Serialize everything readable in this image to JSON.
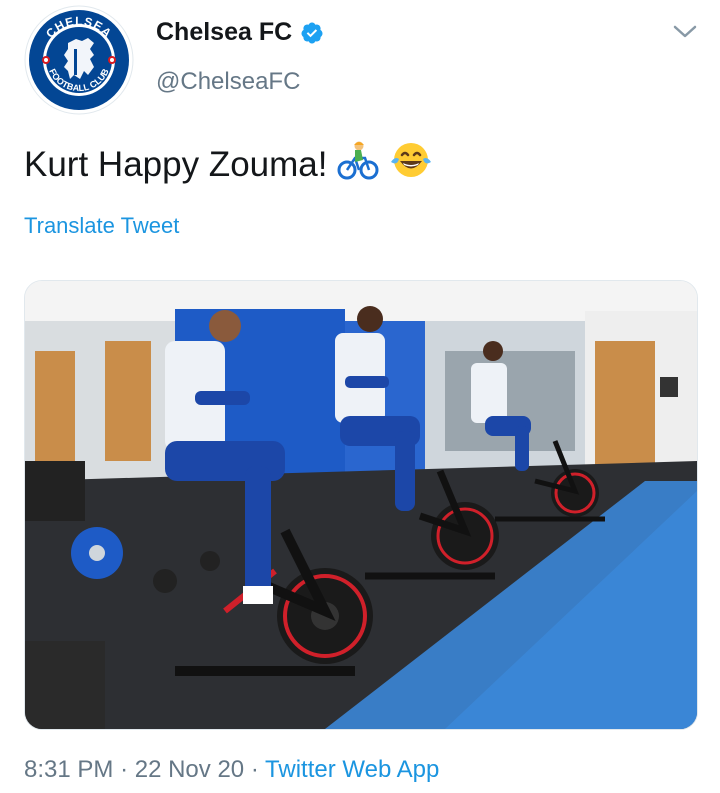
{
  "author": {
    "display_name": "Chelsea FC",
    "handle": "@ChelseaFC",
    "verified": true,
    "avatar_icon": "chelsea-crest-icon",
    "crest_text_top": "CHELSEA",
    "crest_text_bottom": "FOOTBALL CLUB"
  },
  "tweet": {
    "text": "Kurt Happy Zouma!",
    "emojis": [
      "person-biking-emoji",
      "tears-of-joy-emoji"
    ],
    "translate_label": "Translate Tweet"
  },
  "media": {
    "type": "photo",
    "description_icon": "gym-photo-image"
  },
  "footer": {
    "time": "8:31 PM",
    "separator": "·",
    "date": "22 Nov 20",
    "app": "Twitter Web App"
  },
  "colors": {
    "link": "#1b95e0",
    "secondary_text": "#657786",
    "chelsea_blue": "#034694",
    "verified": "#1da1f2"
  }
}
